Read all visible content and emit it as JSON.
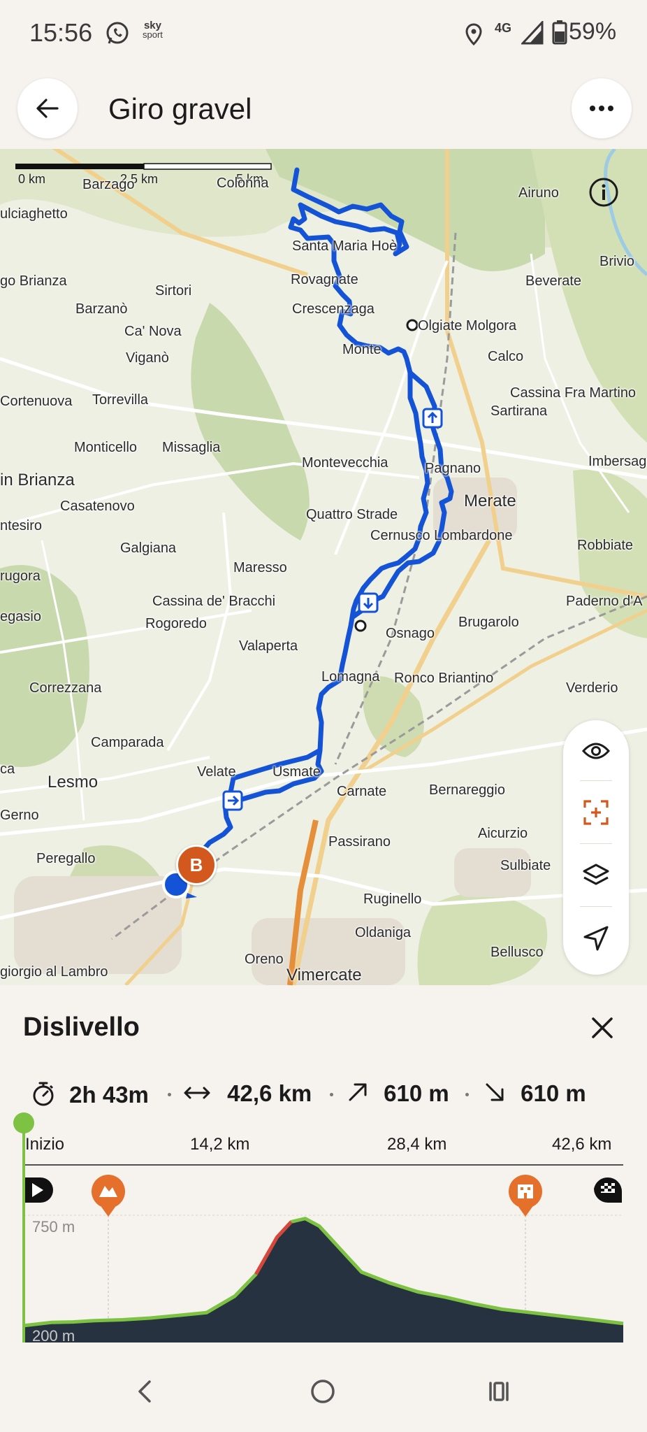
{
  "status": {
    "time": "15:56",
    "carrier_badge_line1": "sky",
    "carrier_badge_line2": "sport",
    "network": "4G",
    "battery": "59%"
  },
  "header": {
    "title": "Giro gravel"
  },
  "map": {
    "scale_labels": [
      "0 km",
      "2,5 km",
      "5 km"
    ],
    "places": [
      {
        "name": "Barzago"
      },
      {
        "name": "Colonna"
      },
      {
        "name": "Airuno"
      },
      {
        "name": "ulciaghetto"
      },
      {
        "name": "Santa Maria Hoè"
      },
      {
        "name": "Brivio"
      },
      {
        "name": "go Brianza"
      },
      {
        "name": "Sirtori"
      },
      {
        "name": "Rovagnate"
      },
      {
        "name": "Beverate"
      },
      {
        "name": "Barzanò"
      },
      {
        "name": "Crescenzaga"
      },
      {
        "name": "Ca' Nova"
      },
      {
        "name": "Olgiate Molgora"
      },
      {
        "name": "Viganò"
      },
      {
        "name": "Monte"
      },
      {
        "name": "Calco"
      },
      {
        "name": "Cortenuova"
      },
      {
        "name": "Torrevilla"
      },
      {
        "name": "Cassina Fra Martino"
      },
      {
        "name": "Sartirana"
      },
      {
        "name": "Monticello"
      },
      {
        "name": "Missaglia"
      },
      {
        "name": "Imbersag"
      },
      {
        "name": "Montevecchia"
      },
      {
        "name": "Pagnano"
      },
      {
        "name": "in Brianza"
      },
      {
        "name": "Merate"
      },
      {
        "name": "Casatenovo"
      },
      {
        "name": "Quattro Strade"
      },
      {
        "name": "ntesiro"
      },
      {
        "name": "Cernusco Lombardone"
      },
      {
        "name": "Galgiana"
      },
      {
        "name": "Robbiate"
      },
      {
        "name": "Maresso"
      },
      {
        "name": "rugora"
      },
      {
        "name": "Cassina de' Bracchi"
      },
      {
        "name": "Paderno d'A"
      },
      {
        "name": "Rogoredo"
      },
      {
        "name": "Brugarolo"
      },
      {
        "name": "egasio"
      },
      {
        "name": "Osnago"
      },
      {
        "name": "Valaperta"
      },
      {
        "name": "Lomagna"
      },
      {
        "name": "Ronco Briantino"
      },
      {
        "name": "Correzzana"
      },
      {
        "name": "Verderio"
      },
      {
        "name": "Camparada"
      },
      {
        "name": "Usmate"
      },
      {
        "name": "ca"
      },
      {
        "name": "Velate"
      },
      {
        "name": "Lesmo"
      },
      {
        "name": "Carnate"
      },
      {
        "name": "Bernareggio"
      },
      {
        "name": "Gerno"
      },
      {
        "name": "Aicurzio"
      },
      {
        "name": "Peregallo"
      },
      {
        "name": "Passirano"
      },
      {
        "name": "Sulbiate"
      },
      {
        "name": "Ruginello"
      },
      {
        "name": "Oldaniga"
      },
      {
        "name": "Bellusco"
      },
      {
        "name": "Oreno"
      },
      {
        "name": "giorgio al Lambro"
      },
      {
        "name": "Vimercate"
      }
    ],
    "marker_label": "B",
    "controls": [
      "eye-icon",
      "recenter-icon",
      "layers-icon",
      "location-icon"
    ]
  },
  "panel": {
    "title": "Dislivello",
    "stats": {
      "duration": "2h 43m",
      "distance": "42,6 km",
      "ascent": "610 m",
      "descent": "610 m"
    },
    "axis": [
      "Inizio",
      "14,2 km",
      "28,4 km",
      "42,6 km"
    ]
  },
  "chart_data": {
    "type": "area",
    "title": "Dislivello",
    "xlabel": "",
    "ylabel": "",
    "y_tick_labels": [
      "750 m",
      "200 m"
    ],
    "x_tick_labels": [
      "Inizio",
      "14,2 km",
      "28,4 km",
      "42,6 km"
    ],
    "x": [
      0,
      2,
      3.5,
      5,
      7,
      9,
      11,
      13,
      15,
      16.5,
      18,
      19,
      20,
      21,
      22,
      23,
      24,
      26,
      28,
      30,
      32,
      34,
      36,
      38,
      40,
      42.6
    ],
    "series": [
      {
        "values": [
          245,
          260,
          262,
          268,
          272,
          280,
          292,
          305,
          380,
          480,
          650,
          720,
          735,
          700,
          630,
          560,
          490,
          440,
          400,
          375,
          345,
          320,
          305,
          290,
          275,
          255
        ]
      }
    ],
    "ylim": [
      200,
      750
    ],
    "xlim": [
      0,
      42.6
    ],
    "poi_markers": [
      "play-icon",
      "mountain-poi-icon",
      "building-poi-icon",
      "finish-flag-icon"
    ],
    "colors": {
      "fill": "#263240",
      "line": "#7dc243",
      "steep": "#d9453a"
    }
  },
  "colors": {
    "route": "#1553d6",
    "accent": "#d2581d",
    "green": "#7dc243"
  }
}
